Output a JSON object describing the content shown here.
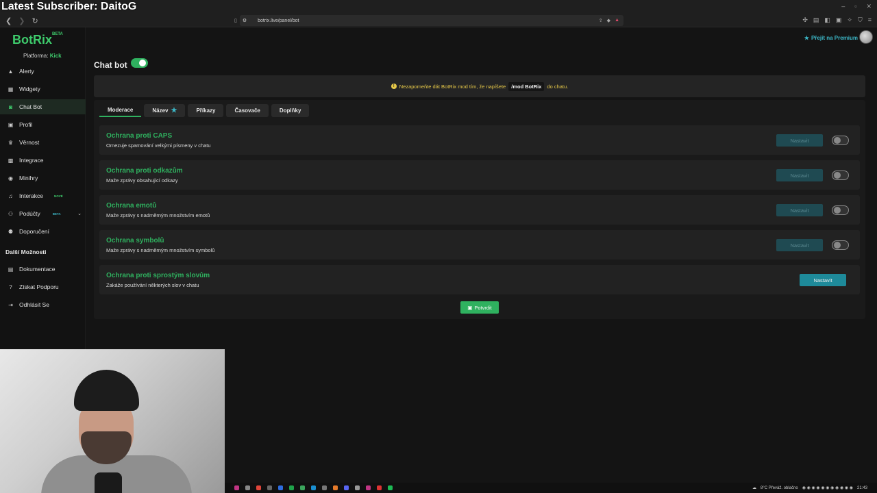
{
  "overlay": {
    "title": "Latest Subscriber: DaitoG"
  },
  "browser": {
    "url": "botrix.live/panel/bot",
    "back_icon": "chevron-left-icon",
    "forward_icon": "chevron-right-icon",
    "reload_icon": "reload-icon"
  },
  "app": {
    "logo": "BotRix",
    "logo_badge": "BETA",
    "platform_label": "Platforma:",
    "platform_value": "Kick",
    "premium_label": "Přejít na Premium"
  },
  "sidebar": {
    "items": [
      {
        "label": "Alerty",
        "icon": "warning-icon"
      },
      {
        "label": "Widgety",
        "icon": "grid-icon"
      },
      {
        "label": "Chat Bot",
        "icon": "bot-icon"
      },
      {
        "label": "Profil",
        "icon": "profile-icon"
      },
      {
        "label": "Věrnost",
        "icon": "trophy-icon"
      },
      {
        "label": "Integrace",
        "icon": "integration-icon"
      },
      {
        "label": "Minihry",
        "icon": "gamepad-icon"
      },
      {
        "label": "Interakce",
        "icon": "music-icon",
        "badge": "NOVÉ"
      },
      {
        "label": "Podúčty",
        "icon": "users-icon",
        "badge": "BETA"
      },
      {
        "label": "Doporučení",
        "icon": "referral-icon"
      }
    ],
    "section_title": "Další Možnosti",
    "extra": [
      {
        "label": "Dokumentace",
        "icon": "docs-icon"
      },
      {
        "label": "Získat Podporu",
        "icon": "help-icon"
      },
      {
        "label": "Odhlásit Se",
        "icon": "logout-icon"
      }
    ]
  },
  "page": {
    "title": "Chat bot",
    "enabled": true,
    "notice_pre": "Nezapomeňte dát BotRix mod tím, že napíšete",
    "notice_code": "/mod BotRix",
    "notice_post": "do chatu.",
    "tabs": [
      {
        "label": "Moderace",
        "active": true
      },
      {
        "label": "Název",
        "active": false,
        "icon": "star-icon"
      },
      {
        "label": "Příkazy",
        "active": false
      },
      {
        "label": "Časovače",
        "active": false
      },
      {
        "label": "Doplňky",
        "active": false
      }
    ],
    "rules": [
      {
        "title": "Ochrana proti CAPS",
        "desc": "Omezuje spamování velkými písmeny v chatu",
        "button": "Nastavit",
        "enabled": false
      },
      {
        "title": "Ochrana proti odkazům",
        "desc": "Maže zprávy obsahující odkazy",
        "button": "Nastavit",
        "enabled": false
      },
      {
        "title": "Ochrana emotů",
        "desc": "Maže zprávy s nadměrným množstvím emotů",
        "button": "Nastavit",
        "enabled": false
      },
      {
        "title": "Ochrana symbolů",
        "desc": "Maže zprávy s nadměrným množstvím symbolů",
        "button": "Nastavit",
        "enabled": false
      },
      {
        "title": "Ochrana proti sprostým slovům",
        "desc": "Zakáže používání některých slov v chatu",
        "button": "Nastavit",
        "enabled": true
      }
    ],
    "confirm_label": "Potvrdit"
  },
  "taskbar": {
    "weather": "8°C  Převáž. oblačno",
    "time": "21:43"
  },
  "colors": {
    "accent": "#2fb15f",
    "teal": "#1e8a9a",
    "warning": "#e7c949"
  }
}
